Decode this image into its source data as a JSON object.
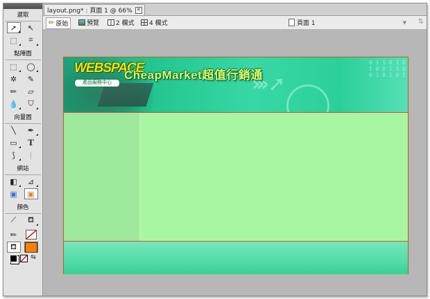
{
  "tools_panel": {
    "sections": [
      {
        "title": "選取",
        "tools": [
          "pointer-icon",
          "subselect-icon",
          "scale-icon",
          "crop-icon"
        ]
      },
      {
        "title": "點陣圖",
        "tools": [
          "marquee-icon",
          "lasso-icon",
          "magic-wand-icon",
          "brush-icon",
          "pencil-icon",
          "eraser-icon",
          "blur-icon",
          "rubber-stamp-icon"
        ]
      },
      {
        "title": "向量圖",
        "tools": [
          "line-icon",
          "pen-icon",
          "rectangle-icon",
          "text-icon",
          "freeform-icon",
          "knife-icon"
        ]
      },
      {
        "title": "網站",
        "tools": [
          "hotspot-icon",
          "slice-icon",
          "hide-slices-icon",
          "show-slices-icon"
        ]
      },
      {
        "title": "顏色",
        "tools": [
          "eyedropper-icon",
          "paint-bucket-icon"
        ]
      }
    ],
    "text_tool_glyph": "T",
    "stroke_color": "#ffffff",
    "fill_color": "#ff8000"
  },
  "document": {
    "tab_title": "layout.png* : 頁面 1 @ 66%",
    "view_buttons": [
      {
        "label": "原始",
        "selected": true
      },
      {
        "label": "預覽",
        "selected": false
      },
      {
        "label": "2 欄式",
        "selected": false
      },
      {
        "label": "4 欄式",
        "selected": false
      }
    ],
    "page_selector": "頁面 1"
  },
  "canvas": {
    "logo_text": "WEBSPACE",
    "logo_slogan": "產品服務中心",
    "site_title": "CheapMarket超值行銷通",
    "banner_digits": "0 1 1 0 1 0\n1 0 0 1 1 0\n0 1 0 1 0 1",
    "colors": {
      "banner": "#2ccf9a",
      "sidebar": "#9ee99b",
      "content": "#a9f6a2",
      "footer": "#57ddab",
      "guides": "#e24646"
    }
  }
}
